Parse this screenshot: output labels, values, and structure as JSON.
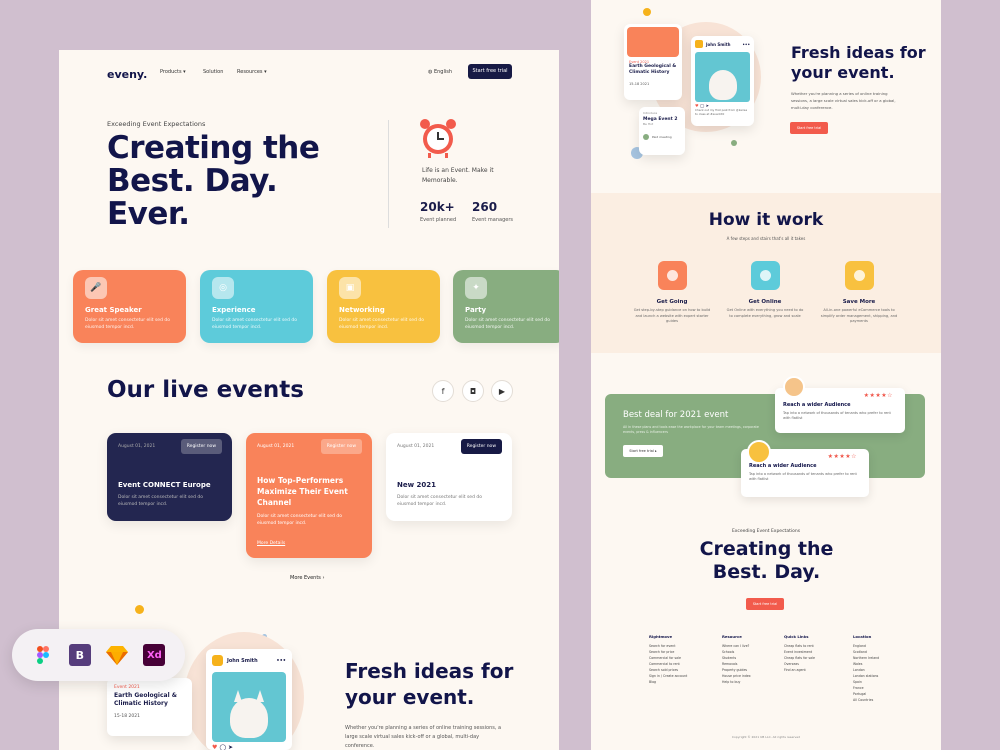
{
  "header": {
    "logo": "eveny.",
    "nav": [
      "Products",
      "Solution",
      "Resources"
    ],
    "language": "English",
    "cta": "Start free trial"
  },
  "hero": {
    "eyebrow": "Exceeding Event Expectations",
    "title": "Creating the Best. Day. Ever.",
    "tagline": "Life is an Event. Make it Memorable.",
    "stats": [
      {
        "value": "20k+",
        "label": "Event planned"
      },
      {
        "value": "260",
        "label": "Event managers"
      }
    ]
  },
  "features": [
    {
      "title": "Great Speaker",
      "desc": "Dolor sit amet consectetur elit sed do eiusmod tempor incd.",
      "color": "#f9835a"
    },
    {
      "title": "Experience",
      "desc": "Dolor sit amet consectetur elit sed do eiusmod tempor incd.",
      "color": "#5dcbda"
    },
    {
      "title": "Networking",
      "desc": "Dolor sit amet consectetur elit sed do eiusmod tempor incd.",
      "color": "#f8c13f"
    },
    {
      "title": "Party",
      "desc": "Dolor sit amet consectetur elit sed do eiusmod tempor incd.",
      "color": "#88ad80"
    }
  ],
  "live": {
    "title": "Our live events",
    "more": "More Events",
    "events": [
      {
        "date": "August 01, 2021",
        "register": "Register now",
        "title": "Event CONNECT Europe",
        "desc": "Dolor sit amet consectetur elit sed do eiusmod tempor incd."
      },
      {
        "date": "August 01, 2021",
        "register": "Register now",
        "title": "How Top-Performers Maximize Their Event Channel",
        "desc": "Dolor sit amet consectetur elit sed do eiusmod tempor incd.",
        "link": "More Details"
      },
      {
        "date": "August 01, 2021",
        "register": "Register now",
        "title": "New 2021",
        "desc": "Dolor sit amet consectetur elit sed do eiusmod tempor incd."
      }
    ]
  },
  "fresh": {
    "title": "Fresh ideas for your event.",
    "desc": "Whether you're planning a series of online training sessions, a large scale virtual sales kick-off or a global, multi-day conference.",
    "cta": "Start free trial",
    "card_event": {
      "tag": "Event 2021",
      "title": "Earth Geological & Climatic History",
      "date": "15-18 2021"
    },
    "insta": {
      "user": "John Smith",
      "caption": "Check out my first post from @karisa to class at #eventX0"
    },
    "mega": {
      "tag": "Introduce",
      "title": "Mega Event 2",
      "sub": "Be Hot",
      "status": "Paid meeting"
    }
  },
  "how": {
    "title": "How it work",
    "subtitle": "A few steps and stairs that's all it takes",
    "steps": [
      {
        "title": "Get Going",
        "desc": "Get step-by-step guidance on how to build and launch a website with expert starter guides",
        "color": "#f9835a"
      },
      {
        "title": "Get Online",
        "desc": "Get Online with everything you need to do to complete everything, grow and scale",
        "color": "#5dcbda"
      },
      {
        "title": "Save More",
        "desc": "All-in-one powerful eCommerce tools to simplify order management, shipping, and payments",
        "color": "#f8c13f"
      }
    ]
  },
  "deal": {
    "title": "Best deal for 2021 event",
    "desc": "All in these plans and tools ease the workplace for your team meetings, corporate events, press & influencers",
    "cta": "Start free trial",
    "reviews": [
      {
        "title": "Reach a wider Audience",
        "desc": "Tap into a network of thousands of tenants who prefer to rent with flatlist",
        "stars": "★★★★☆"
      },
      {
        "title": "Reach a wider Audience",
        "desc": "Tap into a network of thousands of tenants who prefer to rent with flatlist",
        "stars": "★★★★☆"
      }
    ]
  },
  "bottom": {
    "eyebrow": "Exceeding Event Expectations",
    "title": "Creating the Best. Day.",
    "cta": "Start free trial"
  },
  "footer": {
    "columns": [
      {
        "head": "Rightmove",
        "items": [
          "Search for event",
          "Search for price",
          "Commercial for sale",
          "Commercial to rent",
          "Search sold prices",
          "Sign in / Create account",
          "Blog"
        ]
      },
      {
        "head": "Resource",
        "items": [
          "Where can I live?",
          "Schools",
          "Students",
          "Removals",
          "Property guides",
          "House price index",
          "Help to buy"
        ]
      },
      {
        "head": "Quick Links",
        "items": [
          "Cheap flats to rent",
          "Event investment",
          "Cheap flats for sale",
          "Overseas",
          "Find an agent"
        ]
      },
      {
        "head": "Location",
        "items": [
          "England",
          "Scotland",
          "Northern Ireland",
          "Wales",
          "London",
          "London stations",
          "Spain",
          "France",
          "Portugal",
          "All Countries"
        ]
      }
    ],
    "copyright": "Copyright © 2021 UB LLC. All rights reserved"
  },
  "tools": [
    "Figma",
    "Bootstrap",
    "Sketch",
    "Xd"
  ]
}
